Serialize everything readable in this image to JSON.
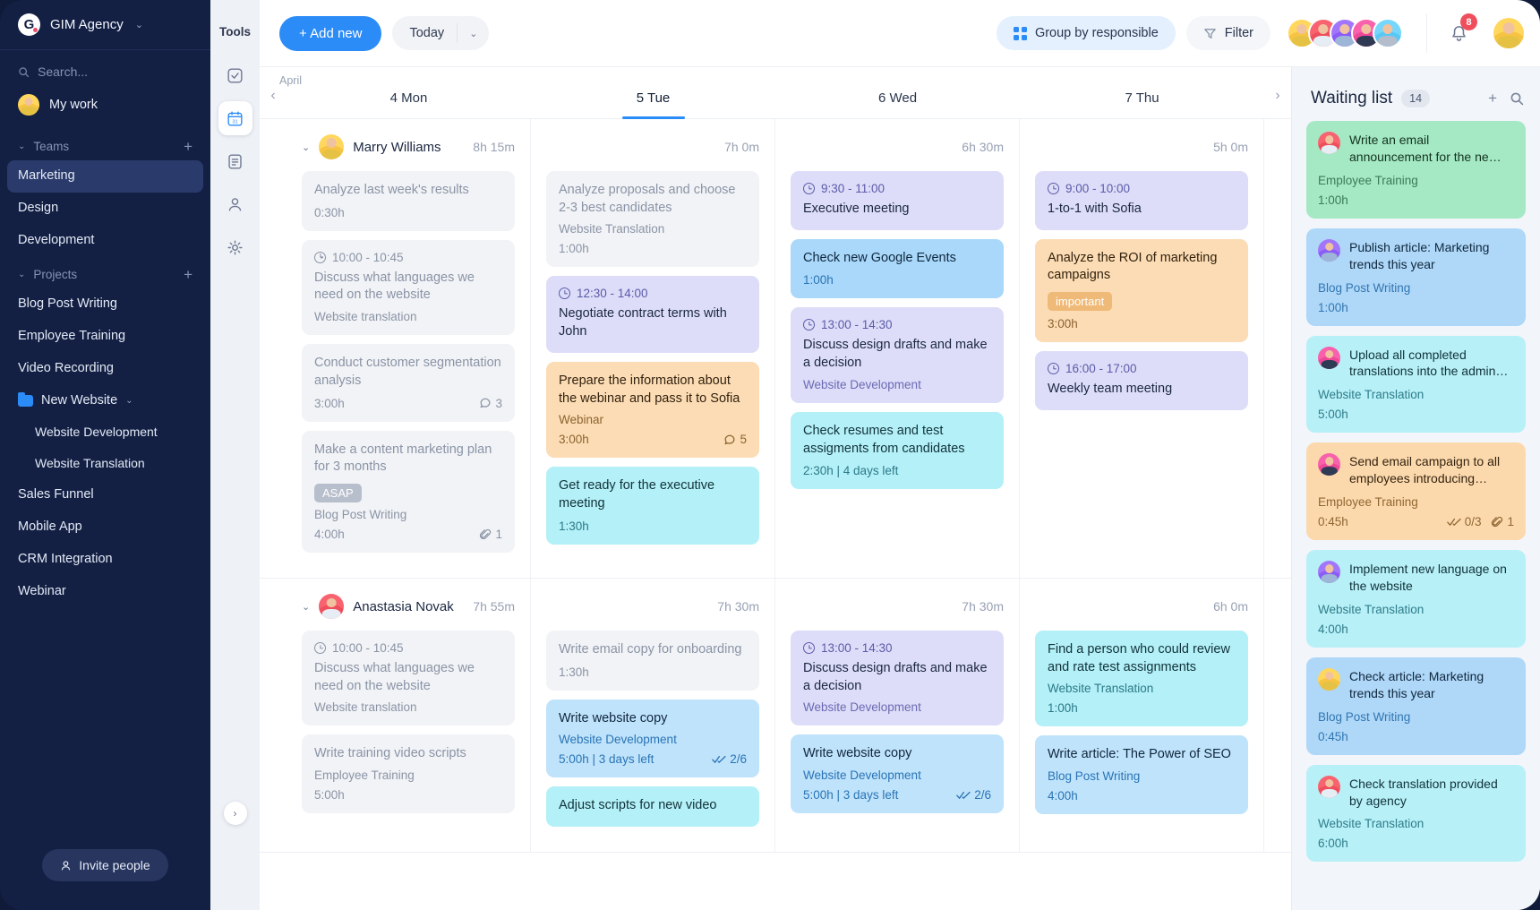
{
  "sidebar": {
    "brand": {
      "logo_letter": "G",
      "name": "GIM Agency",
      "caret": "⌄"
    },
    "search_placeholder": "Search...",
    "my_work": "My work",
    "teams_label": "Teams",
    "teams": [
      "Marketing",
      "Design",
      "Development"
    ],
    "projects_label": "Projects",
    "projects": [
      "Blog Post Writing",
      "Employee Training",
      "Video Recording"
    ],
    "folder": {
      "name": "New Website",
      "children": [
        "Website Development",
        "Website Translation"
      ]
    },
    "projects_after": [
      "Sales Funnel",
      "Mobile App",
      "CRM Integration",
      "Webinar"
    ],
    "invite_label": "Invite people",
    "add_icon": "+"
  },
  "tools": {
    "title": "Tools"
  },
  "topbar": {
    "add_new": "+ Add new",
    "today": "Today",
    "today_caret": "⌄",
    "group_by": "Group by responsible",
    "filter": "Filter",
    "notification_count": "8"
  },
  "calendar": {
    "month": "April",
    "prev_arrow": "‹",
    "next_arrow": "›",
    "days": [
      {
        "label": "4 Mon",
        "today": false
      },
      {
        "label": "5 Tue",
        "today": true
      },
      {
        "label": "6 Wed",
        "today": false
      },
      {
        "label": "7 Thu",
        "today": false
      }
    ],
    "people": [
      {
        "name": "Marry Williams",
        "avatar": "av-yellow sh-yellow",
        "chevron": "⌄",
        "totals": [
          "8h 15m",
          "7h 0m",
          "6h 30m",
          "5h 0m"
        ],
        "columns": [
          [
            {
              "theme": "c-grey",
              "title": "Analyze last week's results",
              "duration": "0:30h"
            },
            {
              "theme": "c-grey",
              "time": "10:00 - 10:45",
              "title": "Discuss what languages we need on the website",
              "project": "Website translation"
            },
            {
              "theme": "c-grey",
              "title": "Conduct customer segmentation analysis",
              "duration": "3:00h",
              "comments": "3"
            },
            {
              "theme": "c-grey",
              "title": "Make a content marketing plan for 3 months",
              "tag": "ASAP",
              "tag_style": "tag-grey",
              "project": "Blog Post Writing",
              "duration": "4:00h",
              "attachments": "1"
            }
          ],
          [
            {
              "theme": "c-grey",
              "title": "Analyze proposals and choose 2-3 best candidates",
              "project": "Website Translation",
              "duration": "1:00h"
            },
            {
              "theme": "c-purple",
              "time": "12:30 - 14:00",
              "title": "Negotiate contract terms with John"
            },
            {
              "theme": "c-orange",
              "title": "Prepare the information about the webinar and pass it to Sofia",
              "project": "Webinar",
              "duration": "3:00h",
              "comments": "5"
            },
            {
              "theme": "c-cyan",
              "title": "Get ready for the executive meeting",
              "duration": "1:30h"
            }
          ],
          [
            {
              "theme": "c-purple",
              "time": "9:30 - 11:00",
              "title": "Executive meeting"
            },
            {
              "theme": "c-blue",
              "title": "Check new Google Events",
              "duration": "1:00h"
            },
            {
              "theme": "c-purple",
              "time": "13:00 - 14:30",
              "title": "Discuss design drafts and make a decision",
              "project": "Website Development"
            },
            {
              "theme": "c-cyan",
              "title": "Check resumes and test assigments from candidates",
              "duration": "2:30h | 4 days left"
            }
          ],
          [
            {
              "theme": "c-purple",
              "time": "9:00 - 10:00",
              "title": "1-to-1 with Sofia"
            },
            {
              "theme": "c-orange",
              "title": "Analyze the ROI of marketing campaigns",
              "tag": "important",
              "duration": "3:00h"
            },
            {
              "theme": "c-purple",
              "time": "16:00 - 17:00",
              "title": "Weekly team meeting"
            }
          ]
        ]
      },
      {
        "name": "Anastasia Novak",
        "avatar": "av-red sh-white",
        "chevron": "⌄",
        "totals": [
          "7h 55m",
          "7h 30m",
          "7h 30m",
          "6h 0m"
        ],
        "columns": [
          [
            {
              "theme": "c-grey",
              "time": "10:00 - 10:45",
              "title": "Discuss what languages we need on the website",
              "project": "Website translation"
            },
            {
              "theme": "c-grey",
              "title": "Write training video scripts",
              "project": "Employee Training",
              "duration": "5:00h"
            }
          ],
          [
            {
              "theme": "c-grey",
              "title": "Write email copy for onboarding",
              "duration": "1:30h"
            },
            {
              "theme": "c-lblue",
              "title": "Write website copy",
              "project": "Website Development",
              "duration": "5:00h | 3 days left",
              "checks": "2/6"
            },
            {
              "theme": "c-cyan",
              "title": "Adjust scripts for new video"
            }
          ],
          [
            {
              "theme": "c-purple",
              "time": "13:00 - 14:30",
              "title": "Discuss design drafts and make a decision",
              "project": "Website Development"
            },
            {
              "theme": "c-lblue",
              "title": "Write website copy",
              "project": "Website Development",
              "duration": "5:00h | 3 days left",
              "checks": "2/6"
            },
            {
              "theme": "c-orange",
              "title": ""
            }
          ],
          [
            {
              "theme": "c-cyan",
              "title": "Find a person who could review and rate test assignments",
              "project": "Website Translation",
              "duration": "1:00h"
            },
            {
              "theme": "c-lblue",
              "title": "Write article: The Power of SEO",
              "project": "Blog Post Writing",
              "duration": "4:00h"
            },
            {
              "theme": "c-purple",
              "title": ""
            }
          ]
        ]
      }
    ]
  },
  "waiting_list": {
    "title": "Waiting list",
    "count": "14",
    "add_icon": "+",
    "search_icon": "⌕",
    "items": [
      {
        "theme": "w-green",
        "avatar": "av-red sh-white",
        "title": "Write an email announcement for the ne…",
        "project": "Employee Training",
        "duration": "1:00h"
      },
      {
        "theme": "w-blue",
        "avatar": "av-purple sh-denim",
        "title": "Publish article: Marketing trends this year",
        "project": "Blog Post Writing",
        "duration": "1:00h"
      },
      {
        "theme": "w-cyan",
        "avatar": "av-pink sh-dark",
        "title": "Upload all completed translations into the admin…",
        "project": "Website Translation",
        "duration": "5:00h"
      },
      {
        "theme": "w-orange",
        "avatar": "av-pink sh-dark",
        "title": "Send email campaign to all employees introducing…",
        "project": "Employee Training",
        "duration": "0:45h",
        "checks": "0/3",
        "attachments": "1"
      },
      {
        "theme": "w-cyan",
        "avatar": "av-purple sh-denim",
        "title": "Implement new language on the website",
        "project": "Website Translation",
        "duration": "4:00h"
      },
      {
        "theme": "w-blue",
        "avatar": "av-yellow sh-yellow",
        "title": "Check article: Marketing trends this year",
        "project": "Blog Post Writing",
        "duration": "0:45h"
      },
      {
        "theme": "w-cyan",
        "avatar": "av-red sh-white",
        "title": "Check translation provided by agency",
        "project": "Website Translation",
        "duration": "6:00h"
      }
    ]
  }
}
